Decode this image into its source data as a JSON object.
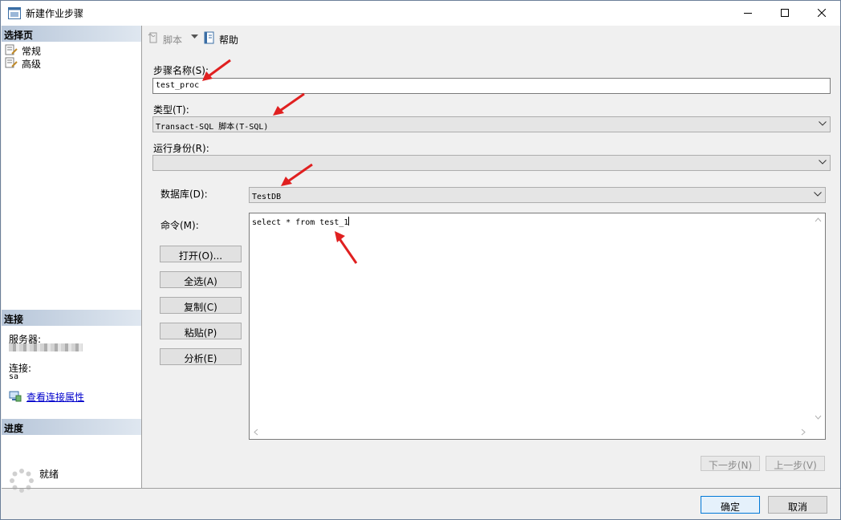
{
  "window": {
    "title": "新建作业步骤",
    "colors": {
      "accent": "#0078d7",
      "annotation": "#e02020",
      "section_header": "#b7c6d9"
    }
  },
  "left_pane": {
    "select_page_header": "选择页",
    "pages": [
      {
        "label": "常规",
        "icon": "page-wrench-icon"
      },
      {
        "label": "高级",
        "icon": "page-wrench-icon"
      }
    ],
    "connection_header": "连接",
    "server_label": "服务器:",
    "connection_label": "连接:",
    "connection_value": "sa",
    "view_connection_link": "查看连接属性",
    "progress_header": "进度",
    "progress_status": "就绪"
  },
  "toolbar": {
    "script_label": "脚本",
    "help_label": "帮助"
  },
  "form": {
    "step_name_label": "步骤名称(S):",
    "step_name_value": "test_proc",
    "type_label": "类型(T):",
    "type_value": "Transact-SQL 脚本(T-SQL)",
    "run_as_label": "运行身份(R):",
    "run_as_value": "",
    "database_label": "数据库(D):",
    "database_value": "TestDB",
    "command_label": "命令(M):",
    "command_value": "select * from test_1",
    "buttons": {
      "open": "打开(O)...",
      "select_all": "全选(A)",
      "copy": "复制(C)",
      "paste": "粘贴(P)",
      "parse": "分析(E)"
    },
    "next_button": "下一步(N)",
    "previous_button": "上一步(V)"
  },
  "footer": {
    "ok_label": "确定",
    "cancel_label": "取消"
  }
}
